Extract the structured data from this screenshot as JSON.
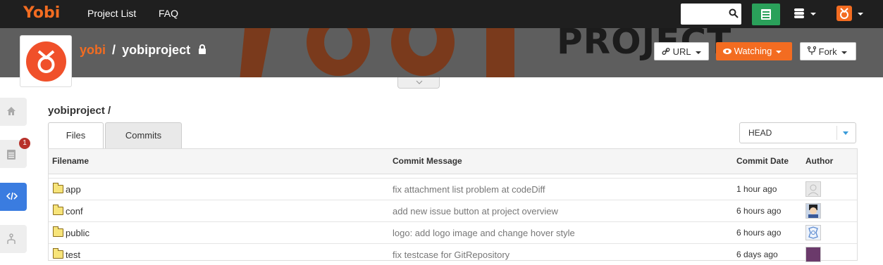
{
  "nav": {
    "brand": "Yobi",
    "links": [
      "Project List",
      "FAQ"
    ]
  },
  "project": {
    "owner": "yobi",
    "separator": "/",
    "name": "yobiproject",
    "banner_word": "PROJECT"
  },
  "header_buttons": {
    "url": "URL",
    "watching": "Watching",
    "fork": "Fork"
  },
  "side_menu": {
    "issues_badge": "1"
  },
  "breadcrumb": "yobiproject /",
  "tabs": [
    "Files",
    "Commits"
  ],
  "branch": "HEAD",
  "table": {
    "headers": [
      "Filename",
      "Commit Message",
      "Commit Date",
      "Author"
    ],
    "rows": [
      {
        "name": "app",
        "message": "fix attachment list problem at codeDiff",
        "date": "1 hour ago"
      },
      {
        "name": "conf",
        "message": "add new issue button at project overview",
        "date": "6 hours ago"
      },
      {
        "name": "public",
        "message": "logo: add logo image and change hover style",
        "date": "6 hours ago"
      },
      {
        "name": "test",
        "message": "fix testcase for GitRepository",
        "date": "6 days ago"
      }
    ]
  },
  "colors": {
    "brand": "#f36c21",
    "nav_bg": "#1f1f1f",
    "new_button": "#2aa15a",
    "active_side": "#3a7ce0"
  }
}
